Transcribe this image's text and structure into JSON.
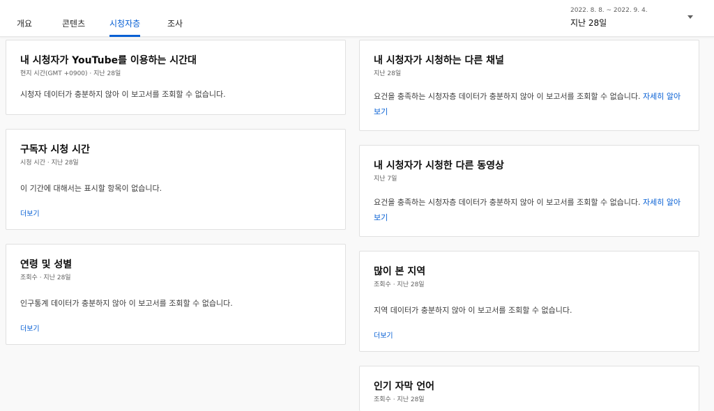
{
  "tabs": [
    {
      "label": "개요"
    },
    {
      "label": "콘텐츠"
    },
    {
      "label": "시청자층"
    },
    {
      "label": "조사"
    }
  ],
  "date_picker": {
    "range": "2022. 8. 8. ~ 2022. 9. 4.",
    "label": "지난 28일"
  },
  "cards": {
    "viewer_time": {
      "title": "내 시청자가 YouTube를 이용하는 시간대",
      "subtitle": "현지 시간(GMT +0900) · 지난 28일",
      "message": "시청자 데이터가 충분하지 않아 이 보고서를 조회할 수 없습니다."
    },
    "subscriber_watch_time": {
      "title": "구독자 시청 시간",
      "subtitle": "시청 시간 · 지난 28일",
      "message": "이 기간에 대해서는 표시할 항목이 없습니다.",
      "more": "더보기"
    },
    "age_gender": {
      "title": "연령 및 성별",
      "subtitle": "조회수 · 지난 28일",
      "message": "인구통계 데이터가 충분하지 않아 이 보고서를 조회할 수 없습니다.",
      "more": "더보기"
    },
    "other_channels": {
      "title": "내 시청자가 시청하는 다른 채널",
      "subtitle": "지난 28일",
      "message": "요건을 충족하는 시청자층 데이터가 충분하지 않아 이 보고서를 조회할 수 없습니다.",
      "link": "자세히 알아보기"
    },
    "other_videos": {
      "title": "내 시청자가 시청한 다른 동영상",
      "subtitle": "지난 7일",
      "message": "요건을 충족하는 시청자층 데이터가 충분하지 않아 이 보고서를 조회할 수 없습니다.",
      "link": "자세히 알아보기"
    },
    "top_geographies": {
      "title": "많이 본 지역",
      "subtitle": "조회수 · 지난 28일",
      "message": "지역 데이터가 충분하지 않아 이 보고서를 조회할 수 없습니다.",
      "more": "더보기"
    },
    "subtitle_languages": {
      "title": "인기 자막 언어",
      "subtitle": "조회수 · 지난 28일"
    }
  },
  "colors": {
    "accent": "#065fd4",
    "card_border": "#e0e0e0",
    "page_bg": "#f9f9f9"
  },
  "icons": {
    "dropdown": "caret-down-icon"
  }
}
